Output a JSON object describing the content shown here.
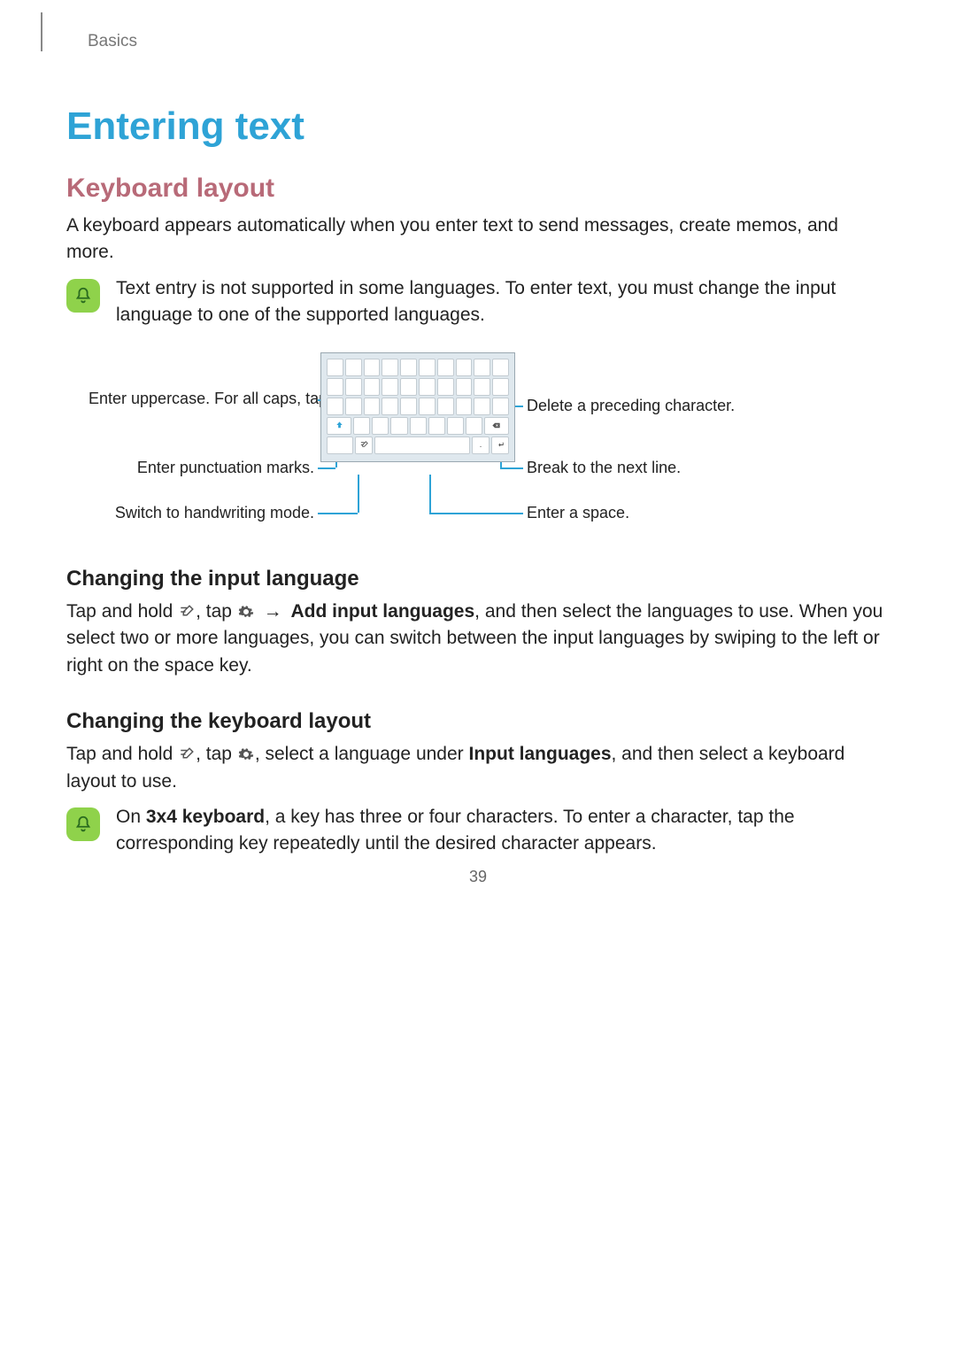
{
  "breadcrumb": "Basics",
  "title": "Entering text",
  "subtitle": "Keyboard layout",
  "intro": "A keyboard appears automatically when you enter text to send messages, create memos, and more.",
  "note1": "Text entry is not supported in some languages. To enter text, you must change the input language to one of the supported languages.",
  "callouts": {
    "uppercase": "Enter uppercase. For all caps, tap it twice.",
    "punct": "Enter punctuation marks.",
    "handwriting": "Switch to handwriting mode.",
    "delete": "Delete a preceding character.",
    "nextline": "Break to the next line.",
    "space": "Enter a space."
  },
  "sect1_title": "Changing the input language",
  "sect1_pre": "Tap and hold ",
  "sect1_mid1": ", tap ",
  "sect1_arrow": "→",
  "sect1_bold": "Add input languages",
  "sect1_post": ", and then select the languages to use. When you select two or more languages, you can switch between the input languages by swiping to the left or right on the space key.",
  "sect2_title": "Changing the keyboard layout",
  "sect2_pre": "Tap and hold ",
  "sect2_mid1": ", tap ",
  "sect2_mid2": ", select a language under ",
  "sect2_bold": "Input languages",
  "sect2_post": ", and then select a keyboard layout to use.",
  "note2_pre": "On ",
  "note2_bold": "3x4 keyboard",
  "note2_post": ", a key has three or four characters. To enter a character, tap the corresponding key repeatedly until the desired character appears.",
  "page_number": "39"
}
